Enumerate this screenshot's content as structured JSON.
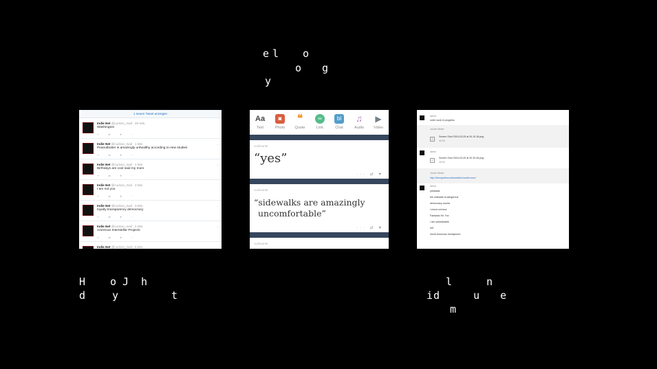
{
  "letters": {
    "top": [
      "e",
      "l",
      "o",
      "o",
      "g",
      "y"
    ],
    "bottom_left": [
      "H",
      "o",
      "J",
      "h",
      "d",
      "y",
      "t"
    ],
    "bottom_right": [
      "l",
      "n",
      "i",
      "d",
      "u",
      "e",
      "m"
    ]
  },
  "twitter": {
    "new_tweets": "1 neuen Tweet anzeigen",
    "tweets": [
      {
        "name": "Indie Net",
        "meta": "@cuckoo_mail · 49 Sek.",
        "text": "Washington"
      },
      {
        "name": "Indie Net",
        "meta": "@cuckoo_mail · 1 Min.",
        "text": "Peanutbutter is amazingly unhealthy according to new studies"
      },
      {
        "name": "Indie Net",
        "meta": "@cuckoo_mail · 2 Min.",
        "text": "Birthdays are cool said my mom"
      },
      {
        "name": "Indie Net",
        "meta": "@cuckoo_mail · 3 Min.",
        "text": "I am not you"
      },
      {
        "name": "Indie Net",
        "meta": "@cuckoo_mail · 3 Min.",
        "text": "loyalty transparency democracy"
      },
      {
        "name": "Indie Net",
        "meta": "@cuckoo_mail · 4 Min.",
        "text": "American Interstellar Projects"
      },
      {
        "name": "Indie Net",
        "meta": "@cuckoo_mail · 5 Min.",
        "text": ""
      }
    ]
  },
  "tumblr": {
    "types": [
      {
        "label": "Text",
        "icon": "Aa",
        "color": "#444444"
      },
      {
        "label": "Photo",
        "icon": "◙",
        "color": "#d95e40"
      },
      {
        "label": "Quote",
        "icon": "❝",
        "color": "#f2992e"
      },
      {
        "label": "Link",
        "icon": "∞",
        "color": "#56bc8a"
      },
      {
        "label": "Chat",
        "icon": "bl",
        "color": "#529ecc"
      },
      {
        "label": "Audio",
        "icon": "♫",
        "color": "#a77dc2"
      },
      {
        "label": "Video",
        "icon": "▶",
        "color": "#748089"
      }
    ],
    "posts": [
      {
        "user": "cuckoonet",
        "quote_line1": "“yes”",
        "quote_line2": ""
      },
      {
        "user": "cuckoonet",
        "quote_line1": "“sidewalks are amazingly",
        "quote_line2": "uncomfortable”"
      },
      {
        "user": "cuckoonet",
        "quote_line1": "",
        "quote_line2": ""
      }
    ],
    "actions": "··· ⇄ ♥"
  },
  "chat": {
    "m1_user": "tamed",
    "m1_text": "unter work in progress",
    "r1_user": "Jochen Weber",
    "r1_file": "Screen Shot 2015-03-25 at 20.10.16.png",
    "r1_size": "41 KB",
    "m2_user": "tamed",
    "r2_file": "Screen Shot 2015-03-25 at 20.33.45.png",
    "r2_size": "44 KB",
    "r3_user": "Jochen Weber",
    "r3_link": "http://thesiyoitherunbluetablet.tumblr.com/",
    "m3_user": "tamed",
    "lines": [
      "yahwaaa",
      "the sidewalk is dangerous",
      "democracy counts",
      "i shout out loud",
      "Fantastic Mr. Fox",
      "I am unbreakable",
      "NO",
      "North American hemisphere"
    ]
  }
}
